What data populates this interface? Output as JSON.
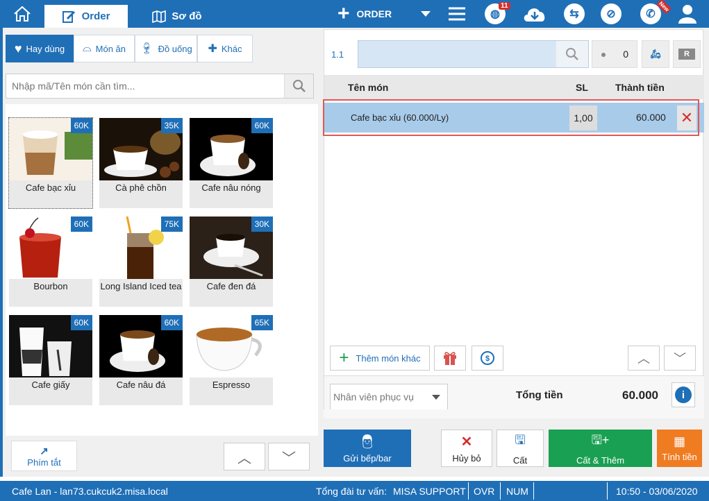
{
  "topbar": {
    "tab_order": "Order",
    "tab_map": "Sơ đồ",
    "add_order_label": "ORDER",
    "notification_count": "11",
    "new_badge": "New"
  },
  "categories": [
    {
      "label": "Hay dùng",
      "icon": "heart-icon"
    },
    {
      "label": "Món ăn",
      "icon": "food-cloche-icon"
    },
    {
      "label": "Đồ uống",
      "icon": "wine-glass-icon"
    },
    {
      "label": "Khác",
      "icon": "puzzle-icon"
    }
  ],
  "search": {
    "placeholder": "Nhập mã/Tên món cần tìm..."
  },
  "items": [
    {
      "name": "Cafe bạc xỉu",
      "price": "60K"
    },
    {
      "name": "Cà phê chồn",
      "price": "35K"
    },
    {
      "name": "Cafe nâu nóng",
      "price": "60K"
    },
    {
      "name": "Bourbon",
      "price": "60K"
    },
    {
      "name": "Long Island Iced tea",
      "price": "75K"
    },
    {
      "name": "Cafe đen đá",
      "price": "30K"
    },
    {
      "name": "Cafe giấy",
      "price": "60K"
    },
    {
      "name": "Cafe nâu đá",
      "price": "60K"
    },
    {
      "name": "Espresso",
      "price": "65K"
    }
  ],
  "left_bottom": {
    "shortcut_label": "Phím tắt"
  },
  "order": {
    "table_number": "1.1",
    "guest_count": "0",
    "header_name": "Tên món",
    "header_qty": "SL",
    "header_amount": "Thành tiền",
    "line": {
      "name": "Cafe bạc xỉu (60.000/Ly)",
      "qty": "1,00",
      "amount": "60.000"
    },
    "add_other_label": "Thêm món khác",
    "staff_placeholder": "Nhân viên phục vụ",
    "total_label": "Tổng tiền",
    "total_value": "60.000"
  },
  "actions": {
    "send": "Gửi bếp/bar",
    "cancel": "Hủy bỏ",
    "save": "Cất",
    "save_add": "Cất & Thêm",
    "calc": "Tính tiền"
  },
  "status": {
    "location": "Cafe Lan - lan73.cukcuk2.misa.local",
    "hotline_label": "Tổng đài tư vấn:",
    "hotline_value": "MISA SUPPORT",
    "ovr": "OVR",
    "num": "NUM",
    "datetime": "10:50 - 03/06/2020"
  },
  "colors": {
    "brand": "#1f6fb7",
    "green": "#1aa052",
    "orange": "#f07c22",
    "red": "#d32f2f"
  }
}
